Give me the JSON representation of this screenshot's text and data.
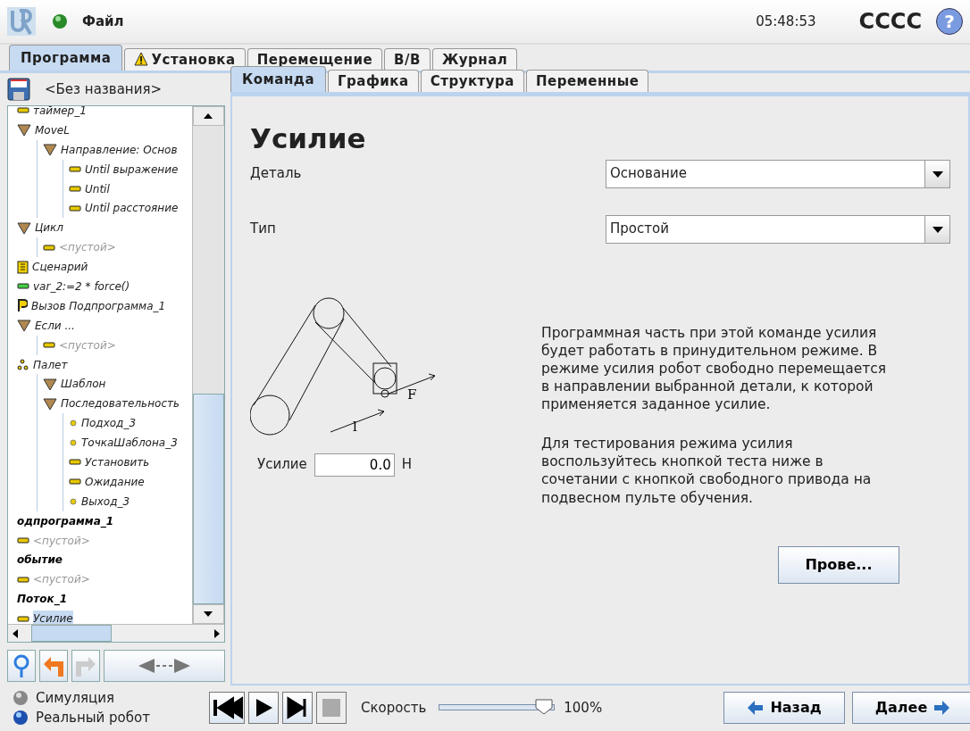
{
  "header": {
    "menu": "Файл",
    "time": "05:48:53",
    "robot_name": "CCCC",
    "help": "?"
  },
  "main_tabs": [
    {
      "label": "Программа",
      "selected": true,
      "warning": false
    },
    {
      "label": "Установка",
      "selected": false,
      "warning": true
    },
    {
      "label": "Перемещение",
      "selected": false,
      "warning": false
    },
    {
      "label": "В/В",
      "selected": false,
      "warning": false
    },
    {
      "label": "Журнал",
      "selected": false,
      "warning": false
    }
  ],
  "program": {
    "name": "<Без названия>"
  },
  "tree": [
    {
      "label": "таймер_1",
      "kind": "action",
      "selected": false
    },
    {
      "label": "MoveL",
      "kind": "folder",
      "selected": false,
      "children": [
        {
          "label": "Направление: Основ",
          "kind": "folder",
          "selected": false,
          "children": [
            {
              "label": "Until выражение",
              "kind": "action",
              "selected": false
            },
            {
              "label": "Until",
              "kind": "action",
              "selected": false
            },
            {
              "label": "Until расстояние",
              "kind": "action",
              "selected": false
            }
          ]
        }
      ]
    },
    {
      "label": "Цикл",
      "kind": "folder",
      "selected": false,
      "children": [
        {
          "label": "<пустой>",
          "kind": "empty",
          "selected": false
        }
      ]
    },
    {
      "label": "Сценарий",
      "kind": "script",
      "selected": false
    },
    {
      "label": "var_2:=2 * force()",
      "kind": "assign",
      "selected": false
    },
    {
      "label": "Вызов Подпрограмма_1",
      "kind": "call",
      "selected": false
    },
    {
      "label": "Если ...",
      "kind": "folder",
      "selected": false,
      "children": [
        {
          "label": "<пустой>",
          "kind": "empty",
          "selected": false
        }
      ]
    },
    {
      "label": "Палет",
      "kind": "pallet",
      "selected": false,
      "children": [
        {
          "label": "Шаблон",
          "kind": "folder",
          "selected": false
        },
        {
          "label": "Последовательность",
          "kind": "folder",
          "selected": false,
          "children": [
            {
              "label": "Подход_3",
              "kind": "waypoint",
              "selected": false
            },
            {
              "label": "ТочкаШаблона_3",
              "kind": "waypoint",
              "selected": false
            },
            {
              "label": "Установить",
              "kind": "action",
              "selected": false
            },
            {
              "label": "Ожидание",
              "kind": "action",
              "selected": false
            },
            {
              "label": "Выход_3",
              "kind": "waypoint",
              "selected": false
            }
          ]
        }
      ]
    },
    {
      "label": "одпрограмма_1",
      "kind": "section",
      "selected": false,
      "children": [
        {
          "label": "<пустой>",
          "kind": "empty",
          "selected": false
        }
      ]
    },
    {
      "label": "обытие",
      "kind": "section",
      "selected": false,
      "children": [
        {
          "label": "<пустой>",
          "kind": "empty",
          "selected": false
        }
      ]
    },
    {
      "label": "Поток_1",
      "kind": "section",
      "selected": false,
      "children": [
        {
          "label": "Усилие",
          "kind": "action",
          "selected": true
        }
      ]
    }
  ],
  "sub_tabs": [
    {
      "label": "Команда",
      "selected": true
    },
    {
      "label": "Графика",
      "selected": false
    },
    {
      "label": "Структура",
      "selected": false
    },
    {
      "label": "Переменные",
      "selected": false
    }
  ],
  "command": {
    "title": "Усилие",
    "fields": [
      {
        "label": "Деталь",
        "value": "Основание"
      },
      {
        "label": "Тип",
        "value": "Простой"
      }
    ],
    "diagram": {
      "force_label": "F",
      "direction_label": "l"
    },
    "force": {
      "label": "Усилие",
      "value": "0.0",
      "unit": "Н"
    },
    "description": [
      "Программная часть при этой команде усилия будет работать в принудительном режиме. В режиме усилия робот свободно перемещается в направлении выбранной детали, к которой применяется заданное усилие.",
      "Для тестирования режима усилия воспользуйтесь кнопкой теста ниже в сочетании с кнопкой свободного привода на подвесном пульте обучения."
    ],
    "test_button": "Прове..."
  },
  "mode": [
    {
      "label": "Симуляция",
      "selected": false
    },
    {
      "label": "Реальный робот",
      "selected": true
    }
  ],
  "transport": [
    {
      "kind": "first",
      "disabled": false
    },
    {
      "kind": "play",
      "disabled": false
    },
    {
      "kind": "step",
      "disabled": false
    },
    {
      "kind": "stop",
      "disabled": true
    }
  ],
  "speed": {
    "label": "Скорость",
    "level": 0.9,
    "reading": "100%"
  },
  "nav": {
    "back": "Назад",
    "next": "Далее"
  }
}
